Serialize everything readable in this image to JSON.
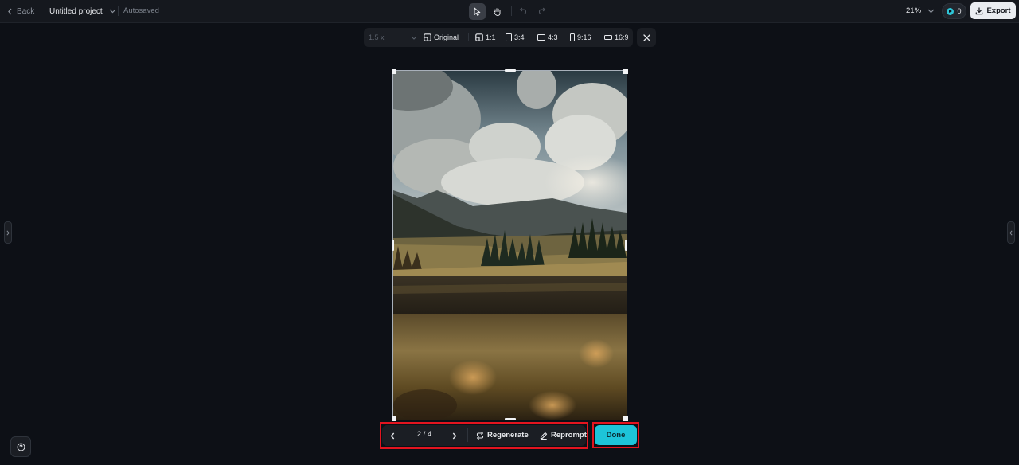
{
  "header": {
    "back_label": "Back",
    "project_title": "Untitled project",
    "save_status": "Autosaved",
    "zoom_level": "21%",
    "credits": "0",
    "export_label": "Export"
  },
  "aspect_bar": {
    "scale_value": "1.5 x",
    "ratios": [
      "Original",
      "1:1",
      "3:4",
      "4:3",
      "9:16",
      "16:9"
    ]
  },
  "icons": {
    "select": "pointer-arrow-icon",
    "pan": "hand-icon",
    "undo": "undo-icon",
    "redo": "redo-icon",
    "close": "close-icon",
    "help": "help-circle-icon"
  },
  "generation_nav": {
    "counter": "2 / 4",
    "regenerate_label": "Regenerate",
    "reprompt_label": "Reprompt",
    "done_label": "Done"
  },
  "colors": {
    "accent": "#1dc4d9",
    "highlight": "#e3141f",
    "background": "#0d1016"
  }
}
